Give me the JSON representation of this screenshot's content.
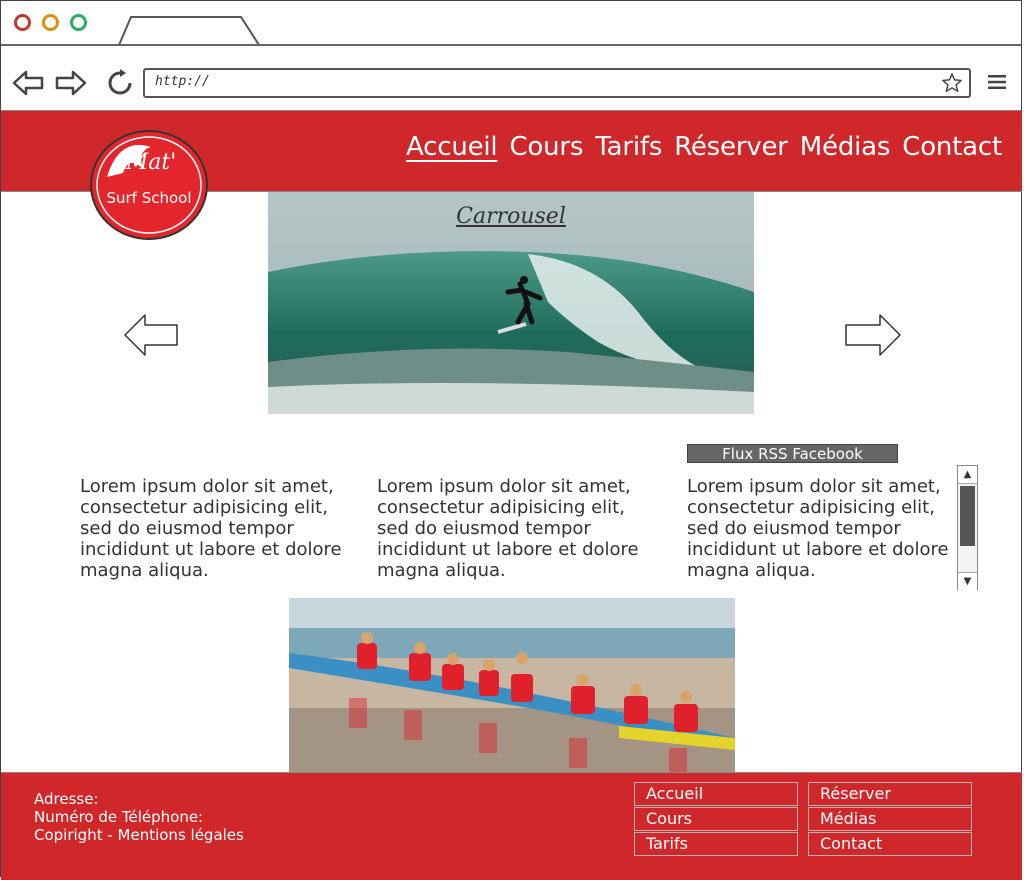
{
  "browser": {
    "address_text": "http://",
    "window_buttons": [
      "close",
      "minimize",
      "maximize"
    ]
  },
  "header": {
    "logo_text_top": "Mat'",
    "logo_text_bottom": "Surf School",
    "nav": [
      {
        "label": "Accueil",
        "active": true
      },
      {
        "label": "Cours",
        "active": false
      },
      {
        "label": "Tarifs",
        "active": false
      },
      {
        "label": "Réserver",
        "active": false
      },
      {
        "label": "Médias",
        "active": false
      },
      {
        "label": "Contact",
        "active": false
      }
    ]
  },
  "carousel": {
    "title": "Carrousel"
  },
  "columns": [
    {
      "text": "Lorem ipsum dolor sit amet, consectetur adipisicing elit, sed do eiusmod tempor incididunt ut labore et dolore magna aliqua."
    },
    {
      "text": "Lorem ipsum dolor sit amet, consectetur adipisicing elit, sed do eiusmod tempor incididunt ut labore et dolore magna aliqua."
    },
    {
      "text": "Lorem ipsum dolor sit amet, consectetur adipisicing elit, sed do eiusmod tempor incididunt ut labore et dolore magna aliqua."
    }
  ],
  "rss": {
    "label": "Flux RSS Facebook"
  },
  "footer": {
    "address": "Adresse:",
    "phone": "Numéro de Téléphone:",
    "legal": "Copiright - Mentions légales",
    "links_left": [
      "Accueil",
      "Cours",
      "Tarifs"
    ],
    "links_right": [
      "Réserver",
      "Médias",
      "Contact"
    ]
  },
  "colors": {
    "brand_red": "#d0272b",
    "close_button": "#c0392b",
    "minimize_button": "#e08e0b",
    "maximize_button": "#27ae60"
  },
  "icons": {
    "back": "back-arrow-icon",
    "forward": "forward-arrow-icon",
    "reload": "reload-icon",
    "bookmark": "star-icon",
    "menu": "hamburger-menu-icon",
    "carousel_prev": "arrow-left-icon",
    "carousel_next": "arrow-right-icon"
  }
}
